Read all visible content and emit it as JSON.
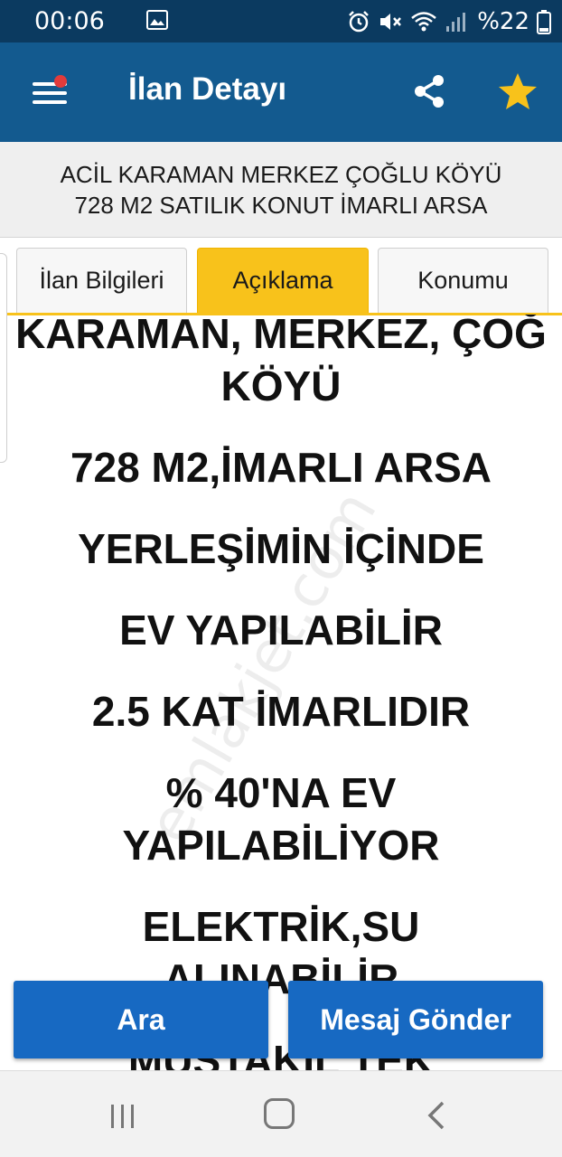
{
  "status_bar": {
    "time": "00:06",
    "battery": "%22",
    "icons": [
      "image-icon",
      "alarm-icon",
      "mute-icon",
      "wifi-icon",
      "signal-icon",
      "battery-icon"
    ]
  },
  "header": {
    "title": "İlan Detayı",
    "icons": [
      "menu-icon",
      "share-icon",
      "star-icon"
    ],
    "colors": {
      "bar": "#135a8f",
      "star": "#f8c21b",
      "notification_dot": "#e23b3b"
    }
  },
  "listing": {
    "title_line1": "ACİL KARAMAN MERKEZ ÇOĞLU KÖYÜ",
    "title_line2": "728 M2 SATILIK KONUT İMARLI ARSA"
  },
  "tabs": [
    {
      "label": "İlan Bilgileri",
      "active": false
    },
    {
      "label": "Açıklama",
      "active": true
    },
    {
      "label": "Konumu",
      "active": false
    }
  ],
  "description": {
    "lines": [
      [
        "KARAMAN, MERKEZ, ÇOĞ",
        "KÖYÜ"
      ],
      [
        "728 M2,İMARLI ARSA"
      ],
      [
        "YERLEŞİMİN İÇİNDE"
      ],
      [
        "EV YAPILABİLİR"
      ],
      [
        "2.5 KAT İMARLIDIR"
      ],
      [
        "% 40'NA EV",
        "YAPILABİLİYOR"
      ],
      [
        "ELEKTRİK,SU",
        "ALINABİLİR"
      ],
      [
        "MÜSTAKİL TEK"
      ]
    ],
    "watermark": "emlakjet.com"
  },
  "actions": {
    "call_label": "Ara",
    "message_label": "Mesaj Gönder",
    "color": "#1769c2"
  },
  "nav": {
    "icons": [
      "recent-apps-icon",
      "home-icon",
      "back-icon"
    ]
  }
}
